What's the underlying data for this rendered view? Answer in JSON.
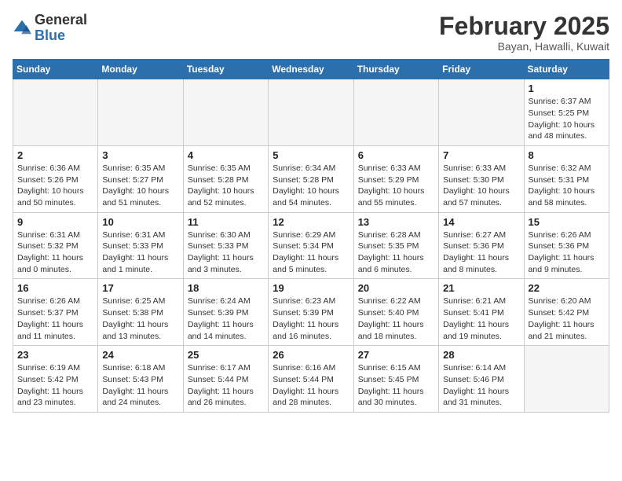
{
  "header": {
    "logo_general": "General",
    "logo_blue": "Blue",
    "month_title": "February 2025",
    "location": "Bayan, Hawalli, Kuwait"
  },
  "weekdays": [
    "Sunday",
    "Monday",
    "Tuesday",
    "Wednesday",
    "Thursday",
    "Friday",
    "Saturday"
  ],
  "weeks": [
    [
      {
        "day": "",
        "info": ""
      },
      {
        "day": "",
        "info": ""
      },
      {
        "day": "",
        "info": ""
      },
      {
        "day": "",
        "info": ""
      },
      {
        "day": "",
        "info": ""
      },
      {
        "day": "",
        "info": ""
      },
      {
        "day": "1",
        "info": "Sunrise: 6:37 AM\nSunset: 5:25 PM\nDaylight: 10 hours and 48 minutes."
      }
    ],
    [
      {
        "day": "2",
        "info": "Sunrise: 6:36 AM\nSunset: 5:26 PM\nDaylight: 10 hours and 50 minutes."
      },
      {
        "day": "3",
        "info": "Sunrise: 6:35 AM\nSunset: 5:27 PM\nDaylight: 10 hours and 51 minutes."
      },
      {
        "day": "4",
        "info": "Sunrise: 6:35 AM\nSunset: 5:28 PM\nDaylight: 10 hours and 52 minutes."
      },
      {
        "day": "5",
        "info": "Sunrise: 6:34 AM\nSunset: 5:28 PM\nDaylight: 10 hours and 54 minutes."
      },
      {
        "day": "6",
        "info": "Sunrise: 6:33 AM\nSunset: 5:29 PM\nDaylight: 10 hours and 55 minutes."
      },
      {
        "day": "7",
        "info": "Sunrise: 6:33 AM\nSunset: 5:30 PM\nDaylight: 10 hours and 57 minutes."
      },
      {
        "day": "8",
        "info": "Sunrise: 6:32 AM\nSunset: 5:31 PM\nDaylight: 10 hours and 58 minutes."
      }
    ],
    [
      {
        "day": "9",
        "info": "Sunrise: 6:31 AM\nSunset: 5:32 PM\nDaylight: 11 hours and 0 minutes."
      },
      {
        "day": "10",
        "info": "Sunrise: 6:31 AM\nSunset: 5:33 PM\nDaylight: 11 hours and 1 minute."
      },
      {
        "day": "11",
        "info": "Sunrise: 6:30 AM\nSunset: 5:33 PM\nDaylight: 11 hours and 3 minutes."
      },
      {
        "day": "12",
        "info": "Sunrise: 6:29 AM\nSunset: 5:34 PM\nDaylight: 11 hours and 5 minutes."
      },
      {
        "day": "13",
        "info": "Sunrise: 6:28 AM\nSunset: 5:35 PM\nDaylight: 11 hours and 6 minutes."
      },
      {
        "day": "14",
        "info": "Sunrise: 6:27 AM\nSunset: 5:36 PM\nDaylight: 11 hours and 8 minutes."
      },
      {
        "day": "15",
        "info": "Sunrise: 6:26 AM\nSunset: 5:36 PM\nDaylight: 11 hours and 9 minutes."
      }
    ],
    [
      {
        "day": "16",
        "info": "Sunrise: 6:26 AM\nSunset: 5:37 PM\nDaylight: 11 hours and 11 minutes."
      },
      {
        "day": "17",
        "info": "Sunrise: 6:25 AM\nSunset: 5:38 PM\nDaylight: 11 hours and 13 minutes."
      },
      {
        "day": "18",
        "info": "Sunrise: 6:24 AM\nSunset: 5:39 PM\nDaylight: 11 hours and 14 minutes."
      },
      {
        "day": "19",
        "info": "Sunrise: 6:23 AM\nSunset: 5:39 PM\nDaylight: 11 hours and 16 minutes."
      },
      {
        "day": "20",
        "info": "Sunrise: 6:22 AM\nSunset: 5:40 PM\nDaylight: 11 hours and 18 minutes."
      },
      {
        "day": "21",
        "info": "Sunrise: 6:21 AM\nSunset: 5:41 PM\nDaylight: 11 hours and 19 minutes."
      },
      {
        "day": "22",
        "info": "Sunrise: 6:20 AM\nSunset: 5:42 PM\nDaylight: 11 hours and 21 minutes."
      }
    ],
    [
      {
        "day": "23",
        "info": "Sunrise: 6:19 AM\nSunset: 5:42 PM\nDaylight: 11 hours and 23 minutes."
      },
      {
        "day": "24",
        "info": "Sunrise: 6:18 AM\nSunset: 5:43 PM\nDaylight: 11 hours and 24 minutes."
      },
      {
        "day": "25",
        "info": "Sunrise: 6:17 AM\nSunset: 5:44 PM\nDaylight: 11 hours and 26 minutes."
      },
      {
        "day": "26",
        "info": "Sunrise: 6:16 AM\nSunset: 5:44 PM\nDaylight: 11 hours and 28 minutes."
      },
      {
        "day": "27",
        "info": "Sunrise: 6:15 AM\nSunset: 5:45 PM\nDaylight: 11 hours and 30 minutes."
      },
      {
        "day": "28",
        "info": "Sunrise: 6:14 AM\nSunset: 5:46 PM\nDaylight: 11 hours and 31 minutes."
      },
      {
        "day": "",
        "info": ""
      }
    ]
  ]
}
